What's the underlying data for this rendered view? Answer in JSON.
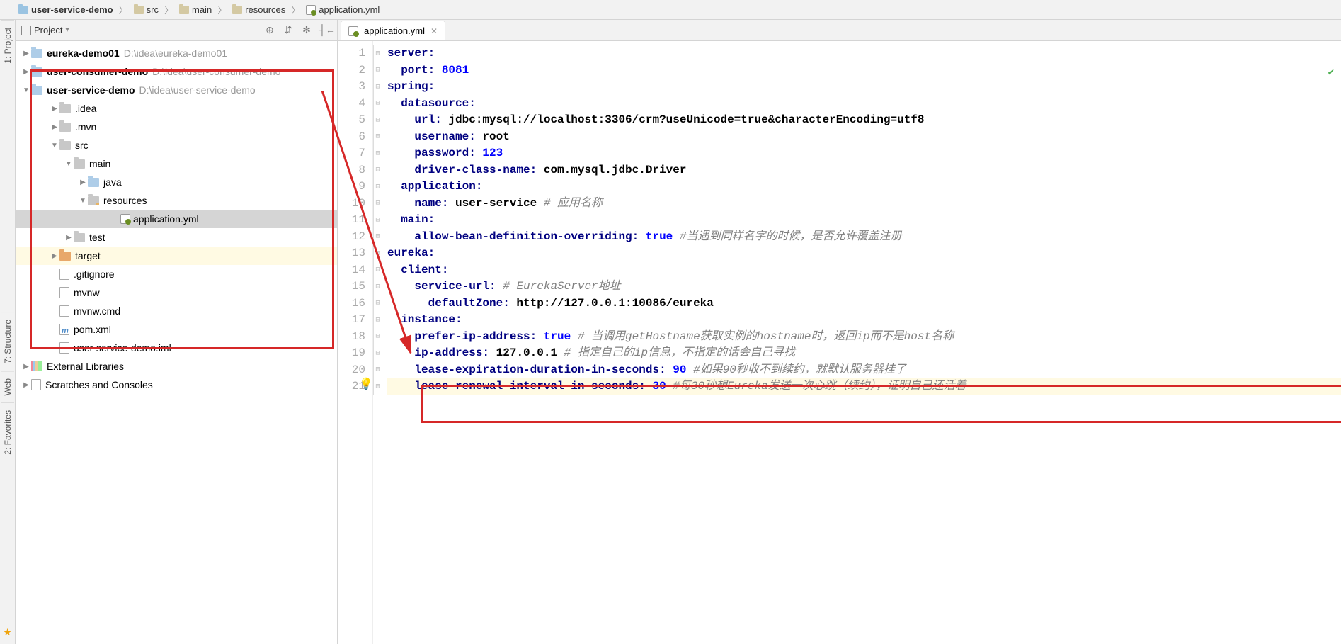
{
  "breadcrumb": [
    "user-service-demo",
    "src",
    "main",
    "resources",
    "application.yml"
  ],
  "gutter": {
    "project": "1: Project",
    "structure": "7: Structure",
    "web": "Web",
    "favorites": "2: Favorites"
  },
  "project_header": {
    "title": "Project"
  },
  "tree": {
    "eureka": {
      "name": "eureka-demo01",
      "path": "D:\\idea\\eureka-demo01"
    },
    "consumer": {
      "name": "user-consumer-demo",
      "path": "D:\\idea\\user-consumer-demo"
    },
    "service": {
      "name": "user-service-demo",
      "path": "D:\\idea\\user-service-demo"
    },
    "idea": ".idea",
    "mvn": ".mvn",
    "src": "src",
    "main": "main",
    "java": "java",
    "resources": "resources",
    "appyml": "application.yml",
    "test": "test",
    "target": "target",
    "gitignore": ".gitignore",
    "mvnw": "mvnw",
    "mvnwcmd": "mvnw.cmd",
    "pom": "pom.xml",
    "iml": "user-service-demo.iml",
    "extlib": "External Libraries",
    "scratches": "Scratches and Consoles"
  },
  "editor": {
    "tab": "application.yml"
  },
  "code_lines": [
    {
      "n": 1,
      "k": "server:",
      "v": "",
      "c": ""
    },
    {
      "n": 2,
      "k": "  port:",
      "v": " 8081",
      "c": ""
    },
    {
      "n": 3,
      "k": "spring:",
      "v": "",
      "c": ""
    },
    {
      "n": 4,
      "k": "  datasource:",
      "v": "",
      "c": ""
    },
    {
      "n": 5,
      "k": "    url:",
      "s": " jdbc:mysql://localhost:3306/crm?useUnicode=true&characterEncoding=utf8",
      "c": ""
    },
    {
      "n": 6,
      "k": "    username:",
      "s": " root",
      "c": ""
    },
    {
      "n": 7,
      "k": "    password:",
      "v": " 123",
      "c": ""
    },
    {
      "n": 8,
      "k": "    driver-class-name:",
      "s": " com.mysql.jdbc.Driver",
      "c": ""
    },
    {
      "n": 9,
      "k": "  application:",
      "v": "",
      "c": ""
    },
    {
      "n": 10,
      "k": "    name:",
      "s": " user-service ",
      "c": "# 应用名称"
    },
    {
      "n": 11,
      "k": "  main:",
      "v": "",
      "c": ""
    },
    {
      "n": 12,
      "k": "    allow-bean-definition-overriding:",
      "v": " true ",
      "c": "#当遇到同样名字的时候，是否允许覆盖注册"
    },
    {
      "n": 13,
      "k": "eureka:",
      "v": "",
      "c": ""
    },
    {
      "n": 14,
      "k": "  client:",
      "v": "",
      "c": ""
    },
    {
      "n": 15,
      "k": "    service-url:",
      "v": " ",
      "c": "# EurekaServer地址"
    },
    {
      "n": 16,
      "k": "      defaultZone:",
      "s": " http://127.0.0.1:10086/eureka",
      "c": ""
    },
    {
      "n": 17,
      "k": "  instance:",
      "v": "",
      "c": ""
    },
    {
      "n": 18,
      "k": "    prefer-ip-address:",
      "v": " true ",
      "c": "# 当调用getHostname获取实例的hostname时，返回ip而不是host名称"
    },
    {
      "n": 19,
      "k": "    ip-address:",
      "s": " 127.0.0.1 ",
      "c": "# 指定自己的ip信息，不指定的话会自己寻找"
    },
    {
      "n": 20,
      "k": "    lease-expiration-duration-in-seconds:",
      "v": " 90 ",
      "c": "#如果90秒收不到续约，就默认服务器挂了"
    },
    {
      "n": 21,
      "k": "    lease-renewal-interval-in-seconds:",
      "v": " 30 ",
      "c": "#每30秒想Eureka发送一次心跳（续约），证明自己还活着",
      "cursor": true
    }
  ],
  "watermark": ""
}
